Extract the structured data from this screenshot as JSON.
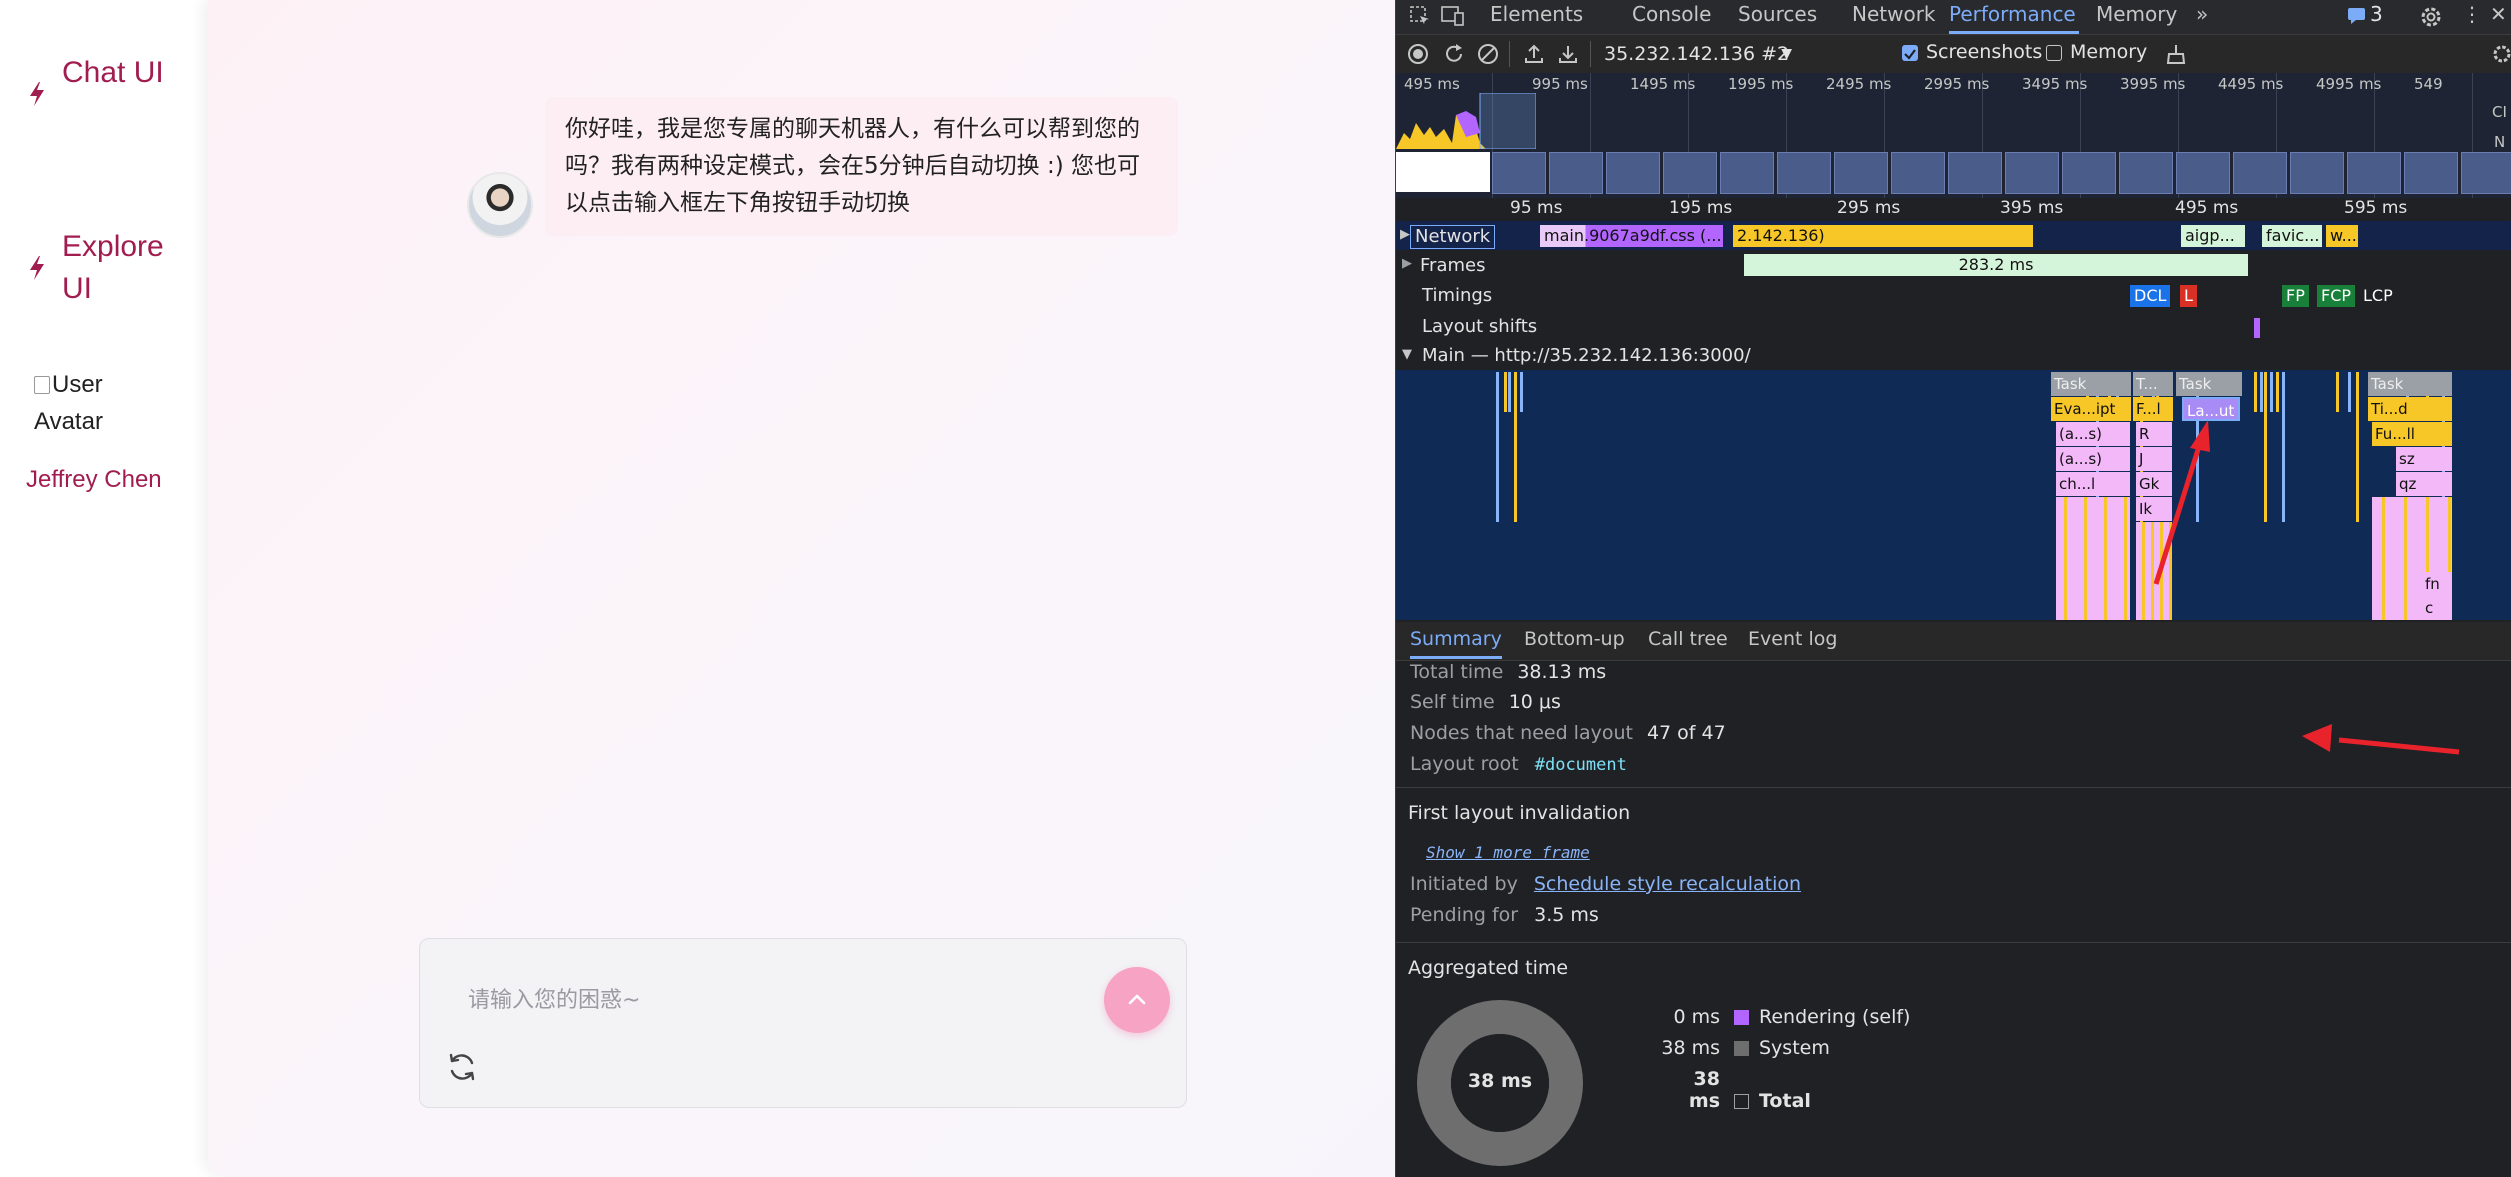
{
  "sidebar": {
    "items": [
      {
        "label": "Chat UI"
      },
      {
        "label": "Explore UI"
      }
    ],
    "avatar_alt": "User Avatar",
    "user_name": "Jeffrey Chen"
  },
  "chat": {
    "bot_message": "你好哇，我是您专属的聊天机器人，有什么可以帮到您的吗？我有两种设定模式，会在5分钟后自动切换 :) 您也可以点击输入框左下角按钮手动切换",
    "input_placeholder": "请输入您的困惑~"
  },
  "devtools": {
    "tabs": [
      "Elements",
      "Console",
      "Sources",
      "Network",
      "Performance",
      "Memory"
    ],
    "active_tab": "Performance",
    "issues_count": "3",
    "toolbar": {
      "recording_name": "35.232.142.136 #2",
      "screenshots_label": "Screenshots",
      "memory_label": "Memory",
      "screenshots_checked": true,
      "memory_checked": false
    },
    "overview_ticks": [
      "495 ms",
      "995 ms",
      "1495 ms",
      "1995 ms",
      "2495 ms",
      "2995 ms",
      "3495 ms",
      "3995 ms",
      "4495 ms",
      "4995 ms",
      "549"
    ],
    "overview_side_labels": [
      "CI",
      "N"
    ],
    "ruler_ticks": [
      "95 ms",
      "195 ms",
      "295 ms",
      "395 ms",
      "495 ms",
      "595 ms"
    ],
    "tracks": {
      "network_label": "Network",
      "network_bars": [
        "main.9067a9df.css (...",
        "2.142.136)",
        "aigp...",
        "favic...",
        "w..."
      ],
      "frames_label": "Frames",
      "frames_value": "283.2 ms",
      "timings_label": "Timings",
      "timing_badges": [
        "DCL",
        "L",
        "FP",
        "FCP",
        "LCP"
      ],
      "layout_shifts_label": "Layout shifts",
      "main_label": "Main — http://35.232.142.136:3000/"
    },
    "main_blocks": {
      "task": "Task",
      "task_short": "T...",
      "col1": [
        "Eva...ipt",
        "(a...s)",
        "(a...s)",
        "ch...l"
      ],
      "col2": [
        "F...l",
        "R",
        "J",
        "Gk",
        "Ik"
      ],
      "col3": [
        "La...ut"
      ],
      "col4": [
        "Ti...d",
        "Fu...ll",
        "sz",
        "qz",
        "fn",
        "c"
      ]
    },
    "bottom_tabs": [
      "Summary",
      "Bottom-up",
      "Call tree",
      "Event log"
    ],
    "active_bottom_tab": "Summary",
    "summary": {
      "total_time_key": "Total time",
      "total_time": "38.13 ms",
      "self_time_key": "Self time",
      "self_time": "10 μs",
      "nodes_key": "Nodes that need layout",
      "nodes": "47 of 47",
      "layout_root_key": "Layout root",
      "layout_root": "#document"
    },
    "first_layout": {
      "title": "First layout invalidation",
      "show_more": "Show 1 more frame",
      "initiated_key": "Initiated by",
      "initiated": "Schedule style recalculation",
      "pending_key": "Pending for",
      "pending": "3.5 ms"
    },
    "aggregated": {
      "title": "Aggregated time",
      "donut_label": "38 ms",
      "rows": [
        {
          "value": "0 ms",
          "label": "Rendering (self)",
          "color": "#b266ff"
        },
        {
          "value": "38 ms",
          "label": "System",
          "color": "#6e6e6e"
        },
        {
          "value": "38 ms",
          "label": "Total",
          "color": "transparent"
        }
      ]
    },
    "colors": {
      "accent": "#7cacf8",
      "scripting": "#f7c728",
      "rendering": "#b266ff",
      "annotation_arrow": "#e8232b"
    }
  }
}
